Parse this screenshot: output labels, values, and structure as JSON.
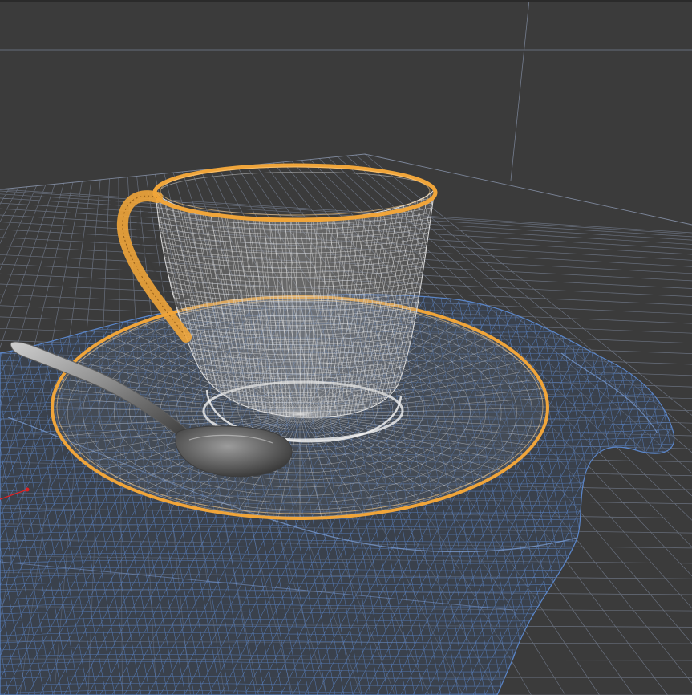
{
  "viewport": {
    "mode": "wireframe",
    "colors": {
      "background": "#3b3b3b",
      "grid": "#8e9bb4",
      "cloth_wire": "#5b86c9",
      "porcelain_wire": "#e6e6e6",
      "gold_rim": "#f0a53a",
      "spoon": "#9a9a9a",
      "axis_marker": "#e02020"
    }
  },
  "scene": {
    "objects": [
      "tablecloth",
      "saucer",
      "teacup",
      "teaspoon"
    ]
  }
}
